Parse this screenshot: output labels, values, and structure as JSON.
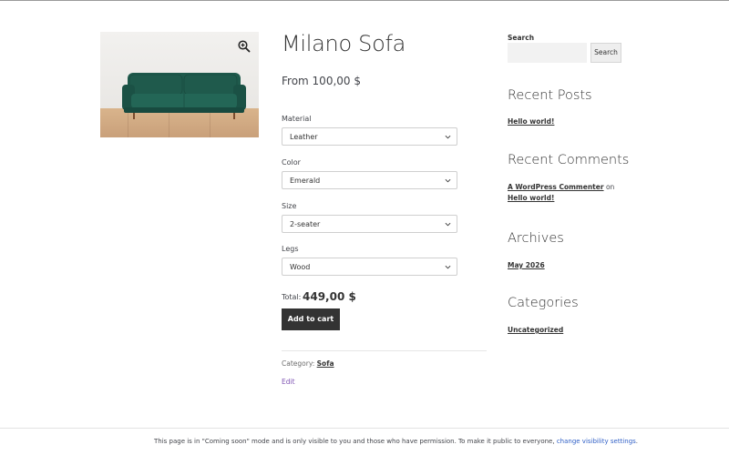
{
  "product": {
    "title": "Milano Sofa",
    "price": "From 100,00 $",
    "image_alt": "green sofa",
    "zoom_icon": "zoom-in-icon"
  },
  "options": [
    {
      "label": "Material",
      "value": "Leather"
    },
    {
      "label": "Color",
      "value": "Emerald"
    },
    {
      "label": "Size",
      "value": "2-seater"
    },
    {
      "label": "Legs",
      "value": "Wood"
    }
  ],
  "total": {
    "label": "Total:",
    "value": "449,00 $"
  },
  "add_to_cart_label": "Add to cart",
  "meta": {
    "category_label": "Category:",
    "category_link": "Sofa",
    "edit_label": "Edit"
  },
  "sidebar": {
    "search_label": "Search",
    "search_button": "Search",
    "search_value": "",
    "recent_posts_title": "Recent Posts",
    "recent_posts": [
      "Hello world!"
    ],
    "recent_comments_title": "Recent Comments",
    "comment": {
      "author": "A WordPress Commenter",
      "on": "on",
      "post": "Hello world!"
    },
    "archives_title": "Archives",
    "archives": [
      "May 2026"
    ],
    "categories_title": "Categories",
    "categories": [
      "Uncategorized"
    ]
  },
  "footer": {
    "text": "This page is in \"Coming soon\" mode and is only visible to you and those who have permission. To make it public to everyone,",
    "link": "change visibility settings",
    "end": "."
  },
  "colors": {
    "button_bg": "#333333",
    "link_purple": "#7f54b3",
    "footer_link": "#2f5fc6",
    "sofa_green": "#1f5a4c"
  }
}
